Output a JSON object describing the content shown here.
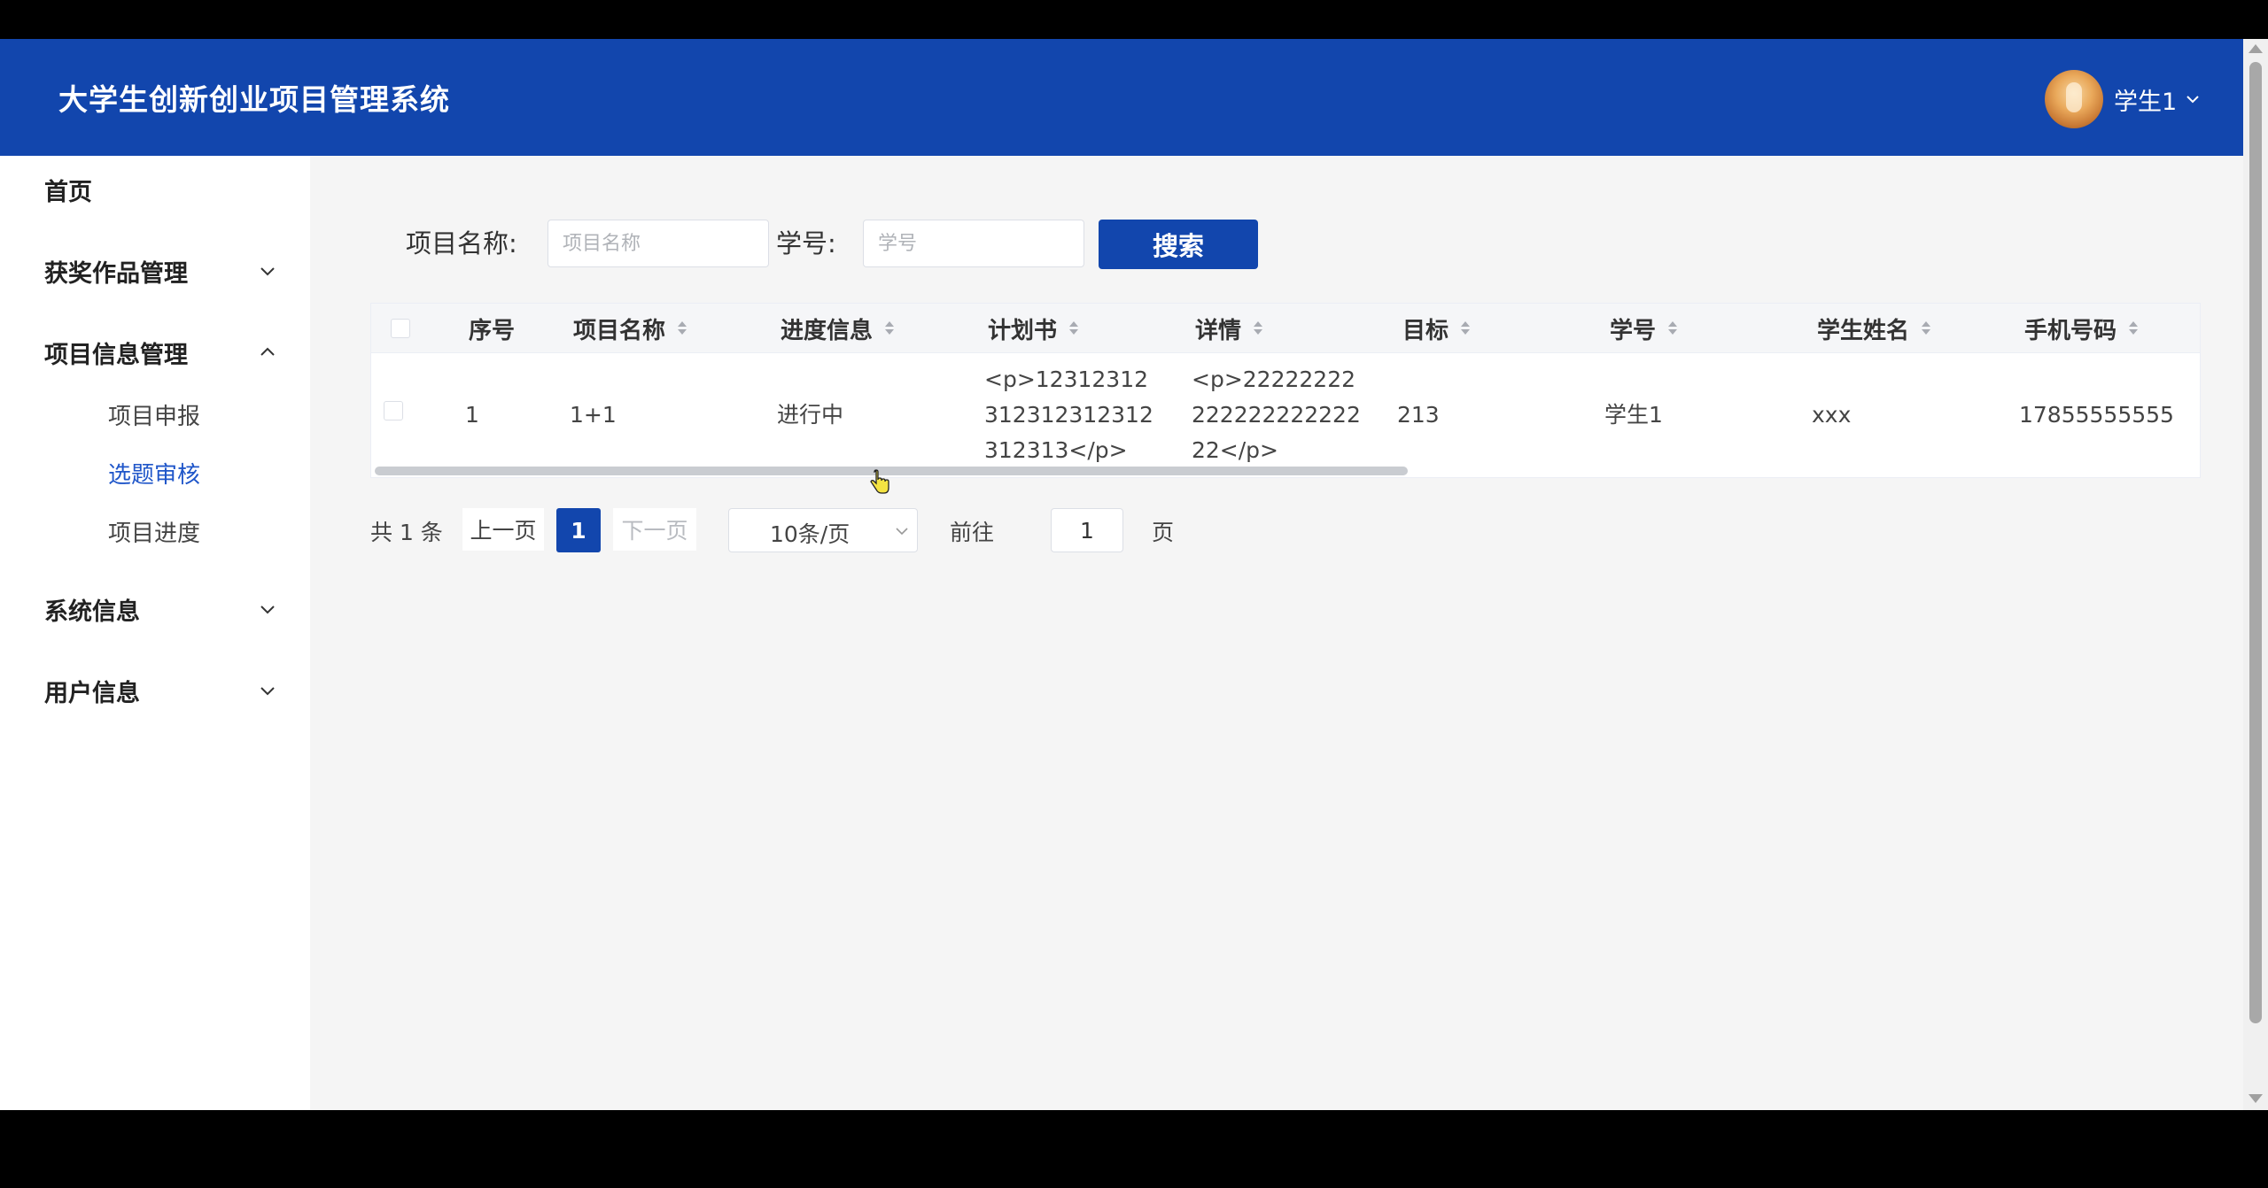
{
  "header": {
    "title": "大学生创新创业项目管理系统",
    "user_name": "学生1"
  },
  "sidebar": {
    "home": "首页",
    "groups": [
      {
        "label": "获奖作品管理",
        "expanded": false
      },
      {
        "label": "项目信息管理",
        "expanded": true,
        "children": [
          "项目申报",
          "选题审核",
          "项目进度"
        ]
      },
      {
        "label": "系统信息",
        "expanded": false
      },
      {
        "label": "用户信息",
        "expanded": false
      }
    ],
    "active_child": "选题审核"
  },
  "search": {
    "project_name_label": "项目名称:",
    "project_name_placeholder": "项目名称",
    "student_no_label": "学号:",
    "student_no_placeholder": "学号",
    "search_button": "搜索"
  },
  "table": {
    "columns": [
      "序号",
      "项目名称",
      "进度信息",
      "计划书",
      "详情",
      "目标",
      "学号",
      "学生姓名",
      "手机号码"
    ],
    "rows": [
      {
        "index": "1",
        "project_name": "1+1",
        "progress": "进行中",
        "plan": "<p>12312312312312312312312313</p>",
        "detail": "<p>2222222222222222222222</p>",
        "goal": "213",
        "student_no": "学生1",
        "student_name": "xxx",
        "phone": "17855555555"
      }
    ]
  },
  "pagination": {
    "total": "共 1 条",
    "prev": "上一页",
    "current_page": "1",
    "next": "下一页",
    "page_size": "10条/页",
    "goto_label": "前往",
    "goto_value": "1",
    "page_unit": "页"
  }
}
